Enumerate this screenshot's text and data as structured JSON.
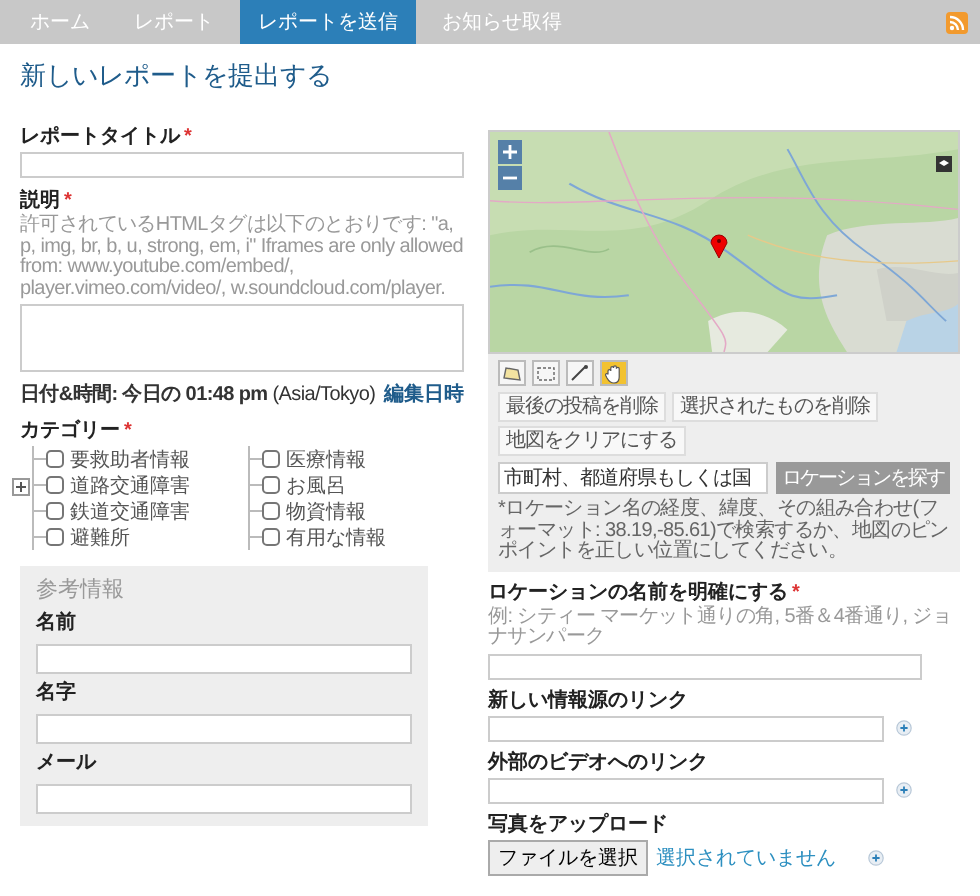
{
  "nav": {
    "items": [
      {
        "label": "ホーム",
        "selected": false
      },
      {
        "label": "レポート",
        "selected": false
      },
      {
        "label": "レポートを送信",
        "selected": true
      },
      {
        "label": "お知らせ取得",
        "selected": false
      }
    ]
  },
  "page_title": "新しいレポートを提出する",
  "report_title": {
    "label": "レポートタイトル",
    "required_mark": "*"
  },
  "description": {
    "label": "説明",
    "required_mark": "*",
    "hint": "許可されているHTMLタグは以下のとおりです: \"a, p, img, br, b, u, strong, em, i\" Iframes are only allowed from: www.youtube.com/embed/, player.vimeo.com/video/, w.soundcloud.com/player."
  },
  "datetime": {
    "text": "**日付&時間: 今日の 01:48 pm** (Asia/Tokyo)",
    "edit_link": "編集日時"
  },
  "categories": {
    "label": "カテゴリー",
    "required_mark": "*",
    "columns": [
      [
        {
          "label": "要救助者情報",
          "checked": false,
          "kind": "item"
        },
        {
          "label": "道路交通障害",
          "checked": false,
          "kind": "group"
        },
        {
          "label": "鉄道交通障害",
          "checked": false,
          "kind": "item"
        },
        {
          "label": "避難所",
          "checked": false,
          "kind": "item"
        }
      ],
      [
        {
          "label": "医療情報",
          "checked": false,
          "kind": "item"
        },
        {
          "label": "お風呂",
          "checked": false,
          "kind": "item"
        },
        {
          "label": "物資情報",
          "checked": false,
          "kind": "item"
        },
        {
          "label": "有用な情報",
          "checked": false,
          "kind": "item"
        }
      ]
    ]
  },
  "reference": {
    "title": "参考情報",
    "fields": [
      "名前",
      "名字",
      "メール"
    ]
  },
  "map": {
    "tools": [
      {
        "kind": "polygon",
        "selected": false
      },
      {
        "kind": "rectangle",
        "selected": false
      },
      {
        "kind": "line",
        "selected": false
      },
      {
        "kind": "pan",
        "selected": true
      }
    ],
    "buttons": [
      "最後の投稿を削除",
      "選択されたものを削除",
      "地図をクリアにする"
    ],
    "search": {
      "placeholder": "市町村、都道府県もしくは国",
      "button": "ロケーションを探す"
    },
    "hint": "*ロケーション名の経度、緯度、その組み合わせ(フォーマット: 38.19,-85.61)で検索するか、地図のピンポイントを正しい位置にしてください。"
  },
  "location_name": {
    "label": "ロケーションの名前を明確にする",
    "required_mark": "*",
    "hint": "例: シティー マーケット通りの角, 5番＆4番通り, ジョナサンパーク"
  },
  "links": [
    {
      "label": "新しい情報源のリンク"
    },
    {
      "label": "外部のビデオへのリンク"
    }
  ],
  "photo": {
    "label": "写真をアップロード",
    "button": "ファイルを選択",
    "status": "選択されていません"
  }
}
